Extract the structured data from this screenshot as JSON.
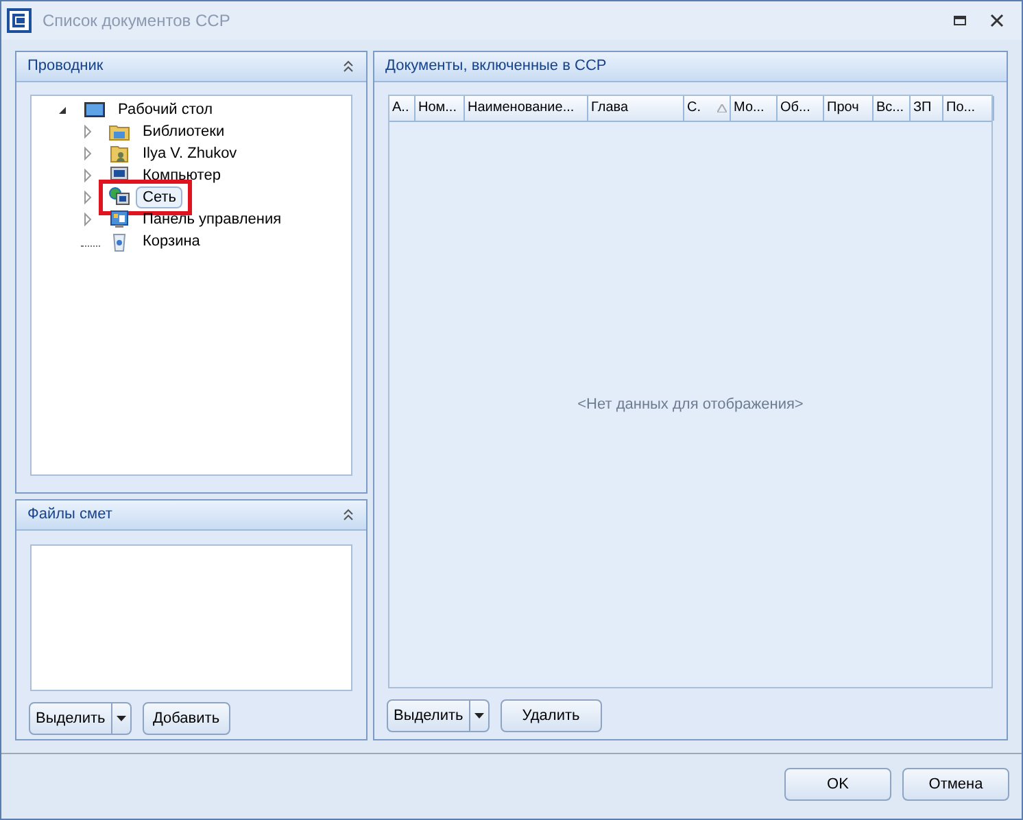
{
  "window": {
    "title": "Список документов ССР"
  },
  "explorer": {
    "title": "Проводник",
    "tree": [
      {
        "label": "Рабочий стол",
        "kind": "desktop",
        "expanded": true,
        "selected": false,
        "marked": false,
        "children": [
          {
            "label": "Библиотеки",
            "kind": "library",
            "expanded": false,
            "selected": false,
            "marked": false
          },
          {
            "label": "Ilya V. Zhukov",
            "kind": "user",
            "expanded": false,
            "selected": false,
            "marked": false
          },
          {
            "label": "Компьютер",
            "kind": "computer",
            "expanded": false,
            "selected": false,
            "marked": false
          },
          {
            "label": "Сеть",
            "kind": "network",
            "expanded": false,
            "selected": true,
            "marked": true
          },
          {
            "label": "Панель управления",
            "kind": "control",
            "expanded": false,
            "selected": false,
            "marked": false
          },
          {
            "label": "Корзина",
            "kind": "trash",
            "selected": false,
            "marked": false
          }
        ]
      }
    ]
  },
  "files": {
    "title": "Файлы смет",
    "buttons": {
      "select": "Выделить",
      "add": "Добавить"
    }
  },
  "documents": {
    "title": "Документы, включенные  в ССР",
    "columns": [
      {
        "label": "А..",
        "sorted": false
      },
      {
        "label": "Ном...",
        "sorted": false
      },
      {
        "label": "Наименование...",
        "sorted": false
      },
      {
        "label": "Глава",
        "sorted": false
      },
      {
        "label": "С.",
        "sorted": true
      },
      {
        "label": "Мо...",
        "sorted": false
      },
      {
        "label": "Об...",
        "sorted": false
      },
      {
        "label": "Проч",
        "sorted": false
      },
      {
        "label": "Вс...",
        "sorted": false
      },
      {
        "label": "ЗП",
        "sorted": false
      },
      {
        "label": "По...",
        "sorted": false
      }
    ],
    "empty_text": "<Нет данных для отображения>",
    "buttons": {
      "select": "Выделить",
      "delete": "Удалить"
    }
  },
  "footer": {
    "ok": "OK",
    "cancel": "Отмена"
  }
}
